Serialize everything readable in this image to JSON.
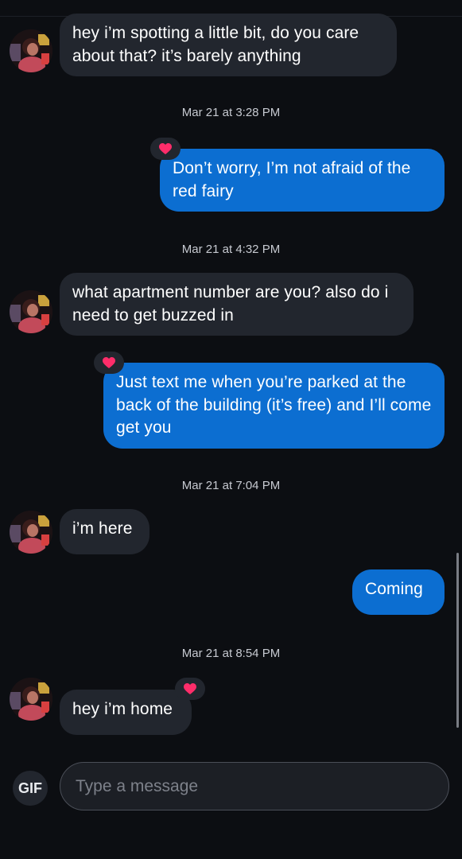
{
  "colors": {
    "background": "#0c0e12",
    "incoming_bubble": "#22262e",
    "outgoing_bubble": "#0c6ed1",
    "reaction_heart": "#ff2d6a",
    "timestamp_text": "#c7cad1"
  },
  "thread": {
    "messages": [
      {
        "direction": "incoming",
        "text": "hey i’m spotting a little bit, do you care about that? it’s barely anything"
      },
      {
        "timestamp": "Mar 21 at 3:28 PM"
      },
      {
        "direction": "outgoing",
        "text": "Don’t worry, I’m not afraid of the red fairy",
        "reaction": "heart-icon"
      },
      {
        "timestamp": "Mar 21 at 4:32 PM"
      },
      {
        "direction": "incoming",
        "text": "what apartment number are you? also do i need to get buzzed in"
      },
      {
        "direction": "outgoing",
        "text": "Just text me when you’re parked at the back of the building (it’s free) and I’ll come get you",
        "reaction": "heart-icon"
      },
      {
        "timestamp": "Mar 21 at 7:04 PM"
      },
      {
        "direction": "incoming",
        "text": "i’m here"
      },
      {
        "direction": "outgoing",
        "text": "Coming"
      },
      {
        "timestamp": "Mar 21 at 8:54 PM"
      },
      {
        "direction": "incoming",
        "text": "hey i’m home",
        "reaction": "heart-icon"
      }
    ]
  },
  "composer": {
    "gif_label": "GIF",
    "placeholder": "Type a message",
    "value": ""
  }
}
